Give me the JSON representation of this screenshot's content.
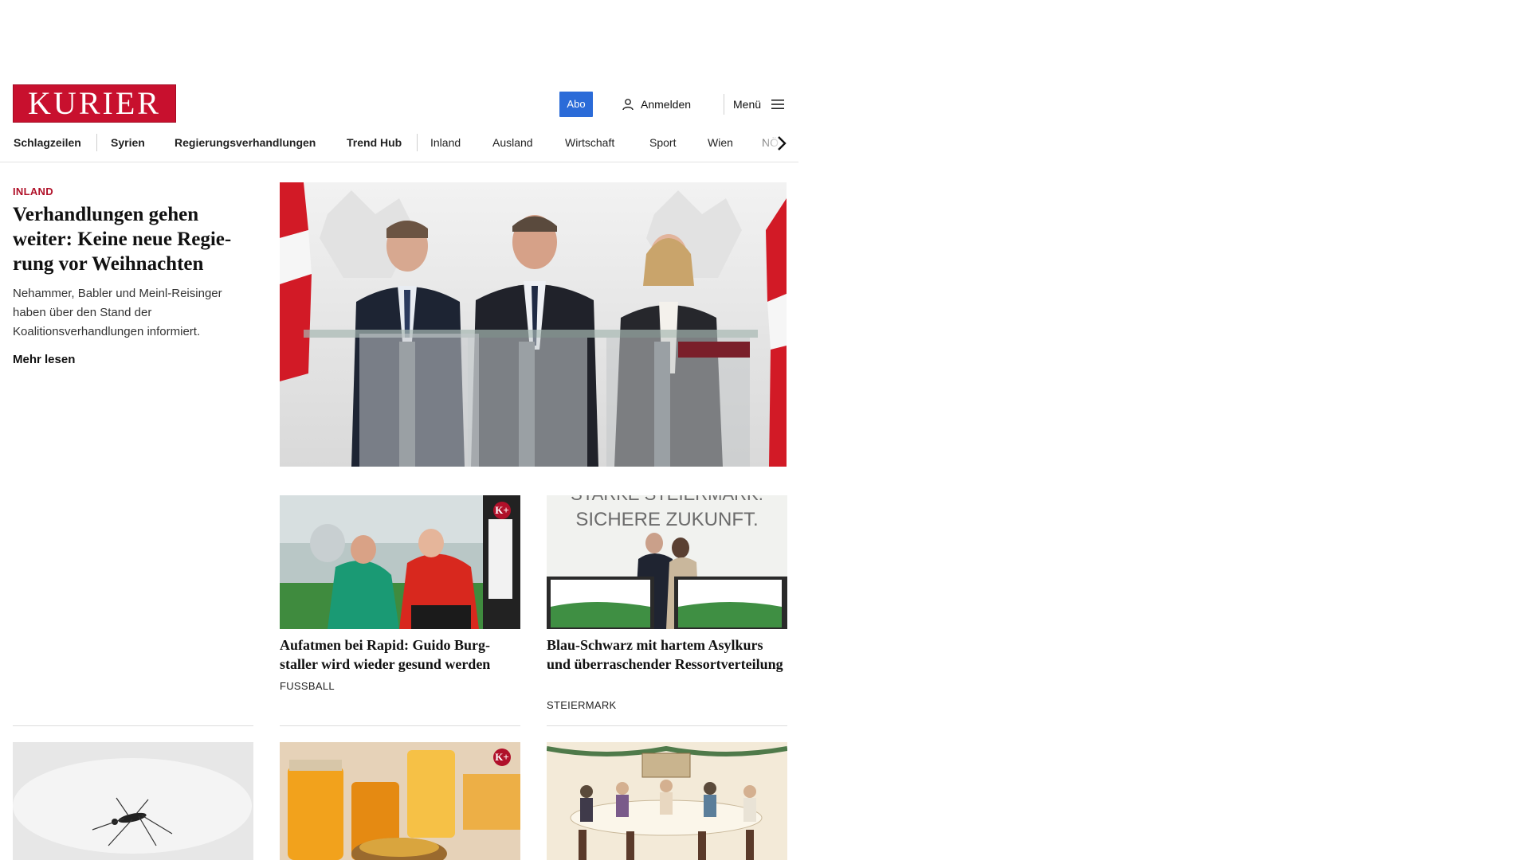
{
  "header": {
    "logo_text": "KURIER",
    "abo_label": "Abo",
    "login_label": "Anmelden",
    "menu_label": "Menü"
  },
  "nav": {
    "items": [
      "Schlagzeilen",
      "Syrien",
      "Regierungsverhandlungen",
      "Trend Hub",
      "Inland",
      "Ausland",
      "Wirtschaft",
      "Sport",
      "Wien",
      "NÖ"
    ]
  },
  "lead": {
    "category": "INLAND",
    "title": "Verhandlungen gehen weiter: Keine neue Regie­rung vor Weihnachten",
    "text": "Nehammer, Babler und Meinl-Reisinger haben über den Stand der Koalitionsverhandlungen informiert.",
    "more_label": "Mehr lesen"
  },
  "teasers": [
    {
      "title": "Aufatmen bei Rapid: Guido Burg­staller wird wieder gesund werden",
      "category": "FUSSBALL",
      "kplus": "K+"
    },
    {
      "title": "Blau-Schwarz mit hartem Asyl­kurs und überraschender Ressortverteilung",
      "category": "STEIERMARK",
      "image_text_1": "STARKE STEIERMARK.",
      "image_text_2": "SICHERE ZUKUNFT."
    }
  ],
  "row2": {
    "kplus": "K+"
  },
  "colors": {
    "brand_red": "#c8102e",
    "abo_blue": "#2b6bd8",
    "category_red": "#b01028"
  },
  "icons": {
    "login": "user-icon",
    "menu": "hamburger-icon",
    "nav_next": "chevron-right-icon",
    "premium": "kplus-badge"
  }
}
